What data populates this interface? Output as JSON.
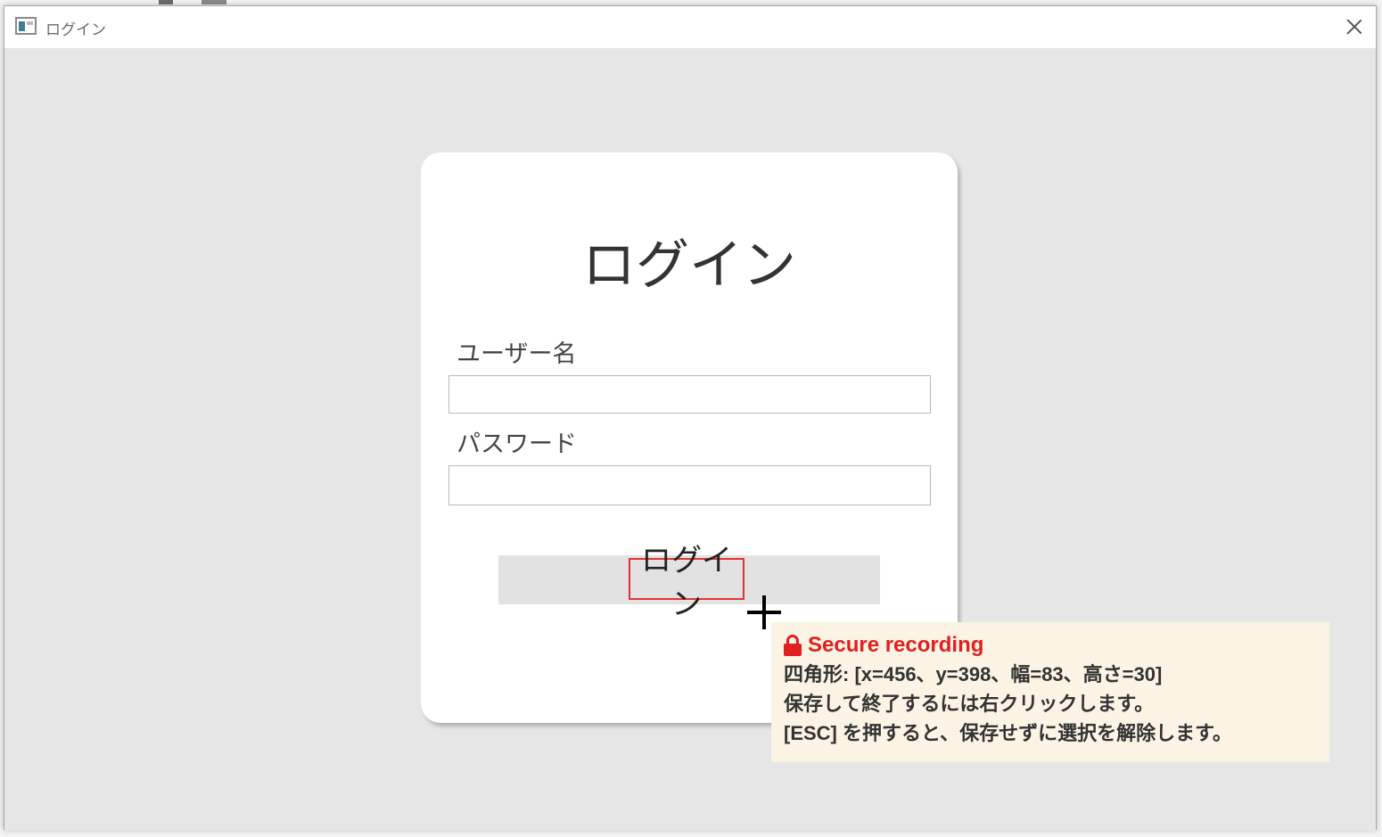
{
  "window": {
    "title": "ログイン",
    "close_icon": "close-icon"
  },
  "login_form": {
    "heading": "ログイン",
    "username_label": "ユーザー名",
    "username_value": "",
    "password_label": "パスワード",
    "password_value": "",
    "submit_label": "ログイン"
  },
  "recording_tooltip": {
    "title": "Secure recording",
    "icon": "lock-icon",
    "lines": [
      "四角形: [x=456、y=398、幅=83、高さ=30]",
      "保存して終了するには右クリックします。",
      "[ESC] を押すると、保存せずに選択を解除します。"
    ],
    "accent_color": "#e02020",
    "background_color": "#fbf3e3"
  },
  "colors": {
    "selection_border": "#e53333",
    "card_background": "#ffffff",
    "client_background": "#e6e6e6"
  }
}
